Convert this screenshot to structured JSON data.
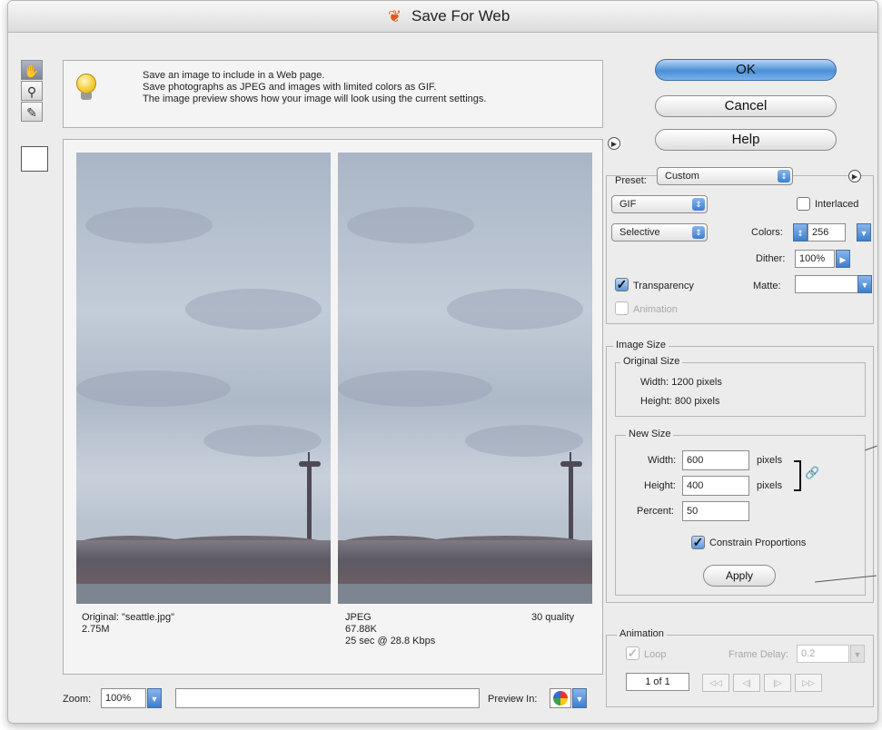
{
  "window": {
    "title": "Save For Web"
  },
  "tools": [
    {
      "name": "hand-tool",
      "glyph": "✋"
    },
    {
      "name": "zoom-tool",
      "glyph": "🔍"
    },
    {
      "name": "eyedropper-tool",
      "glyph": "✎"
    }
  ],
  "info": {
    "line1": "Save an image to include in a Web page.",
    "line2": "Save photographs as JPEG and images with limited colors as GIF.",
    "line3": "The image preview shows how your image will look using the current settings."
  },
  "buttons": {
    "ok": "OK",
    "cancel": "Cancel",
    "help": "Help",
    "apply": "Apply"
  },
  "preview": {
    "original": {
      "line1": "Original: \"seattle.jpg\"",
      "line2": "2.75M"
    },
    "optimized": {
      "format": "JPEG",
      "quality": "30 quality",
      "size": "67.88K",
      "time": "25 sec @ 28.8 Kbps"
    }
  },
  "bottom": {
    "zoom_label": "Zoom:",
    "zoom_value": "100%",
    "preview_label": "Preview In:"
  },
  "settings": {
    "preset_label": "Preset:",
    "preset_value": "Custom",
    "format_value": "GIF",
    "reduction_value": "Selective",
    "interlaced_label": "Interlaced",
    "colors_label": "Colors:",
    "colors_value": "256",
    "dither_label": "Dither:",
    "dither_value": "100%",
    "transparency_label": "Transparency",
    "matte_label": "Matte:",
    "animation_label": "Animation"
  },
  "image_size": {
    "group_label": "Image Size",
    "original_size_label": "Original Size",
    "orig_width": "Width:  1200 pixels",
    "orig_height": "Height:  800 pixels",
    "new_size_label": "New Size",
    "width_label": "Width:",
    "width_value": "600",
    "height_label": "Height:",
    "height_value": "400",
    "percent_label": "Percent:",
    "percent_value": "50",
    "units": "pixels",
    "constrain_label": "Constrain Proportions"
  },
  "animation": {
    "group_label": "Animation",
    "loop_label": "Loop",
    "frame_delay_label": "Frame Delay:",
    "frame_delay_value": "0.2",
    "frame_counter": "1 of 1",
    "nav": [
      "◁◁",
      "◁|",
      "|▷",
      "▷▷"
    ]
  },
  "colors": {
    "accent": "#4a8fd6",
    "checkbox": "#5b98dd",
    "window_bg": "#ececec"
  }
}
